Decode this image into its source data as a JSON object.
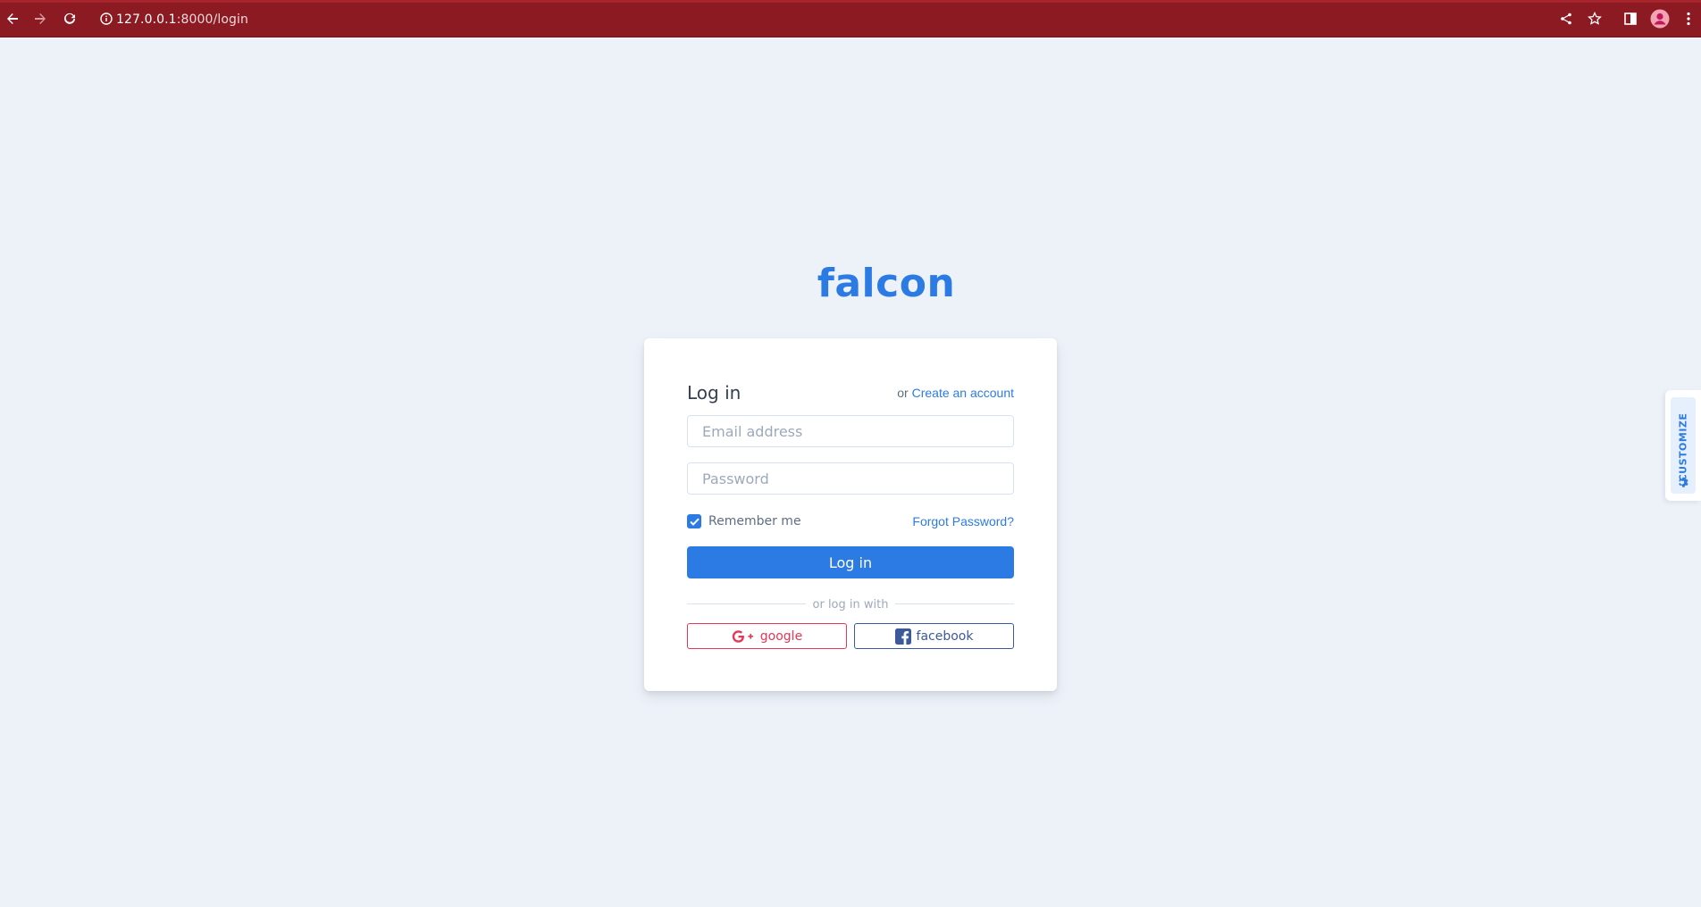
{
  "browser": {
    "url_host": "127.0.0.1",
    "url_rest": ":8000/login",
    "icons": [
      "back-arrow-icon",
      "forward-arrow-icon",
      "reload-icon",
      "info-icon",
      "share-icon",
      "star-icon",
      "side-panel-icon",
      "profile-avatar-icon",
      "more-vert-icon"
    ]
  },
  "logo": {
    "text": "falcon"
  },
  "login": {
    "title": "Log in",
    "alt_prefix": "or",
    "alt_link": "Create an account",
    "email_placeholder": "Email address",
    "password_placeholder": "Password",
    "remember_label": "Remember me",
    "remember_checked": true,
    "forgot_link": "Forgot Password?",
    "submit_label": "Log in",
    "divider_text": "or log in with",
    "google_label": "google",
    "facebook_label": "facebook"
  },
  "customize": {
    "label": "CUSTOMIZE"
  },
  "colors": {
    "primary": "#2c7be5",
    "background": "#edf2f9",
    "browser_bar": "#8b1a22",
    "google": "#e63757",
    "facebook": "#3c5a99"
  }
}
